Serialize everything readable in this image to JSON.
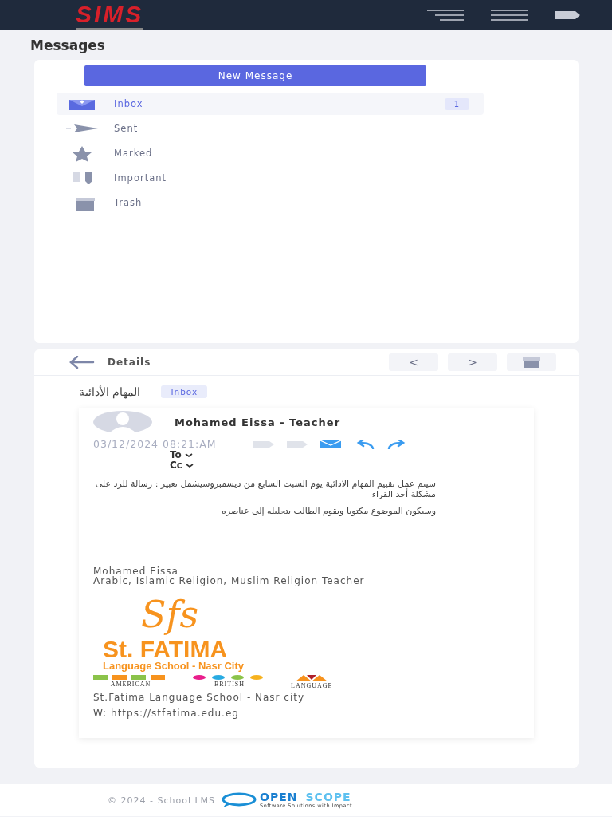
{
  "header": {
    "logo": "SIMS"
  },
  "page_title": "Messages",
  "new_message_button": "New Message",
  "folders": [
    {
      "kind": "inbox",
      "label": "Inbox",
      "selected": true,
      "count": "1"
    },
    {
      "kind": "sent",
      "label": "Sent",
      "selected": false
    },
    {
      "kind": "marked",
      "label": "Marked",
      "selected": false
    },
    {
      "kind": "important",
      "label": "Important",
      "selected": false
    },
    {
      "kind": "trash",
      "label": "Trash",
      "selected": false
    }
  ],
  "details": {
    "title": "Details",
    "prev": "<",
    "next": ">"
  },
  "message": {
    "subject": "المهام الأدائية",
    "folder_tag": "Inbox",
    "sender": "Mohamed Eissa - Teacher",
    "date": "03/12/2024 08:21:AM",
    "to": "To",
    "cc": "Cc",
    "body": [
      "سيتم عمل تقييم المهام الادائية يوم السبت السابع من ديسمبروسيشمل تعبير : رسالة للرد على مشكلة أحد القراء",
      "وسيكون الموضوع مكتوبا ويقوم الطالب بتحليله إلى عناصره"
    ],
    "signature": [
      "Mohamed Eissa",
      "Arabic, Islamic Religion, Muslim Religion Teacher"
    ],
    "school_logo": {
      "monogram": "Sfs",
      "name": "St. FATIMA",
      "subtitle": "Language School - Nasr City",
      "tracks": [
        "AMERICAN",
        "BRITISH",
        "LANGUAGE"
      ]
    },
    "school_line": "St.Fatima Language School - Nasr city",
    "website": "W: https://stfatima.edu.eg"
  },
  "footer": {
    "copyright": "© 2024 - School LMS",
    "brand": [
      "OPEN",
      "SCOPE"
    ],
    "tagline": "Software Solutions with Impact"
  }
}
